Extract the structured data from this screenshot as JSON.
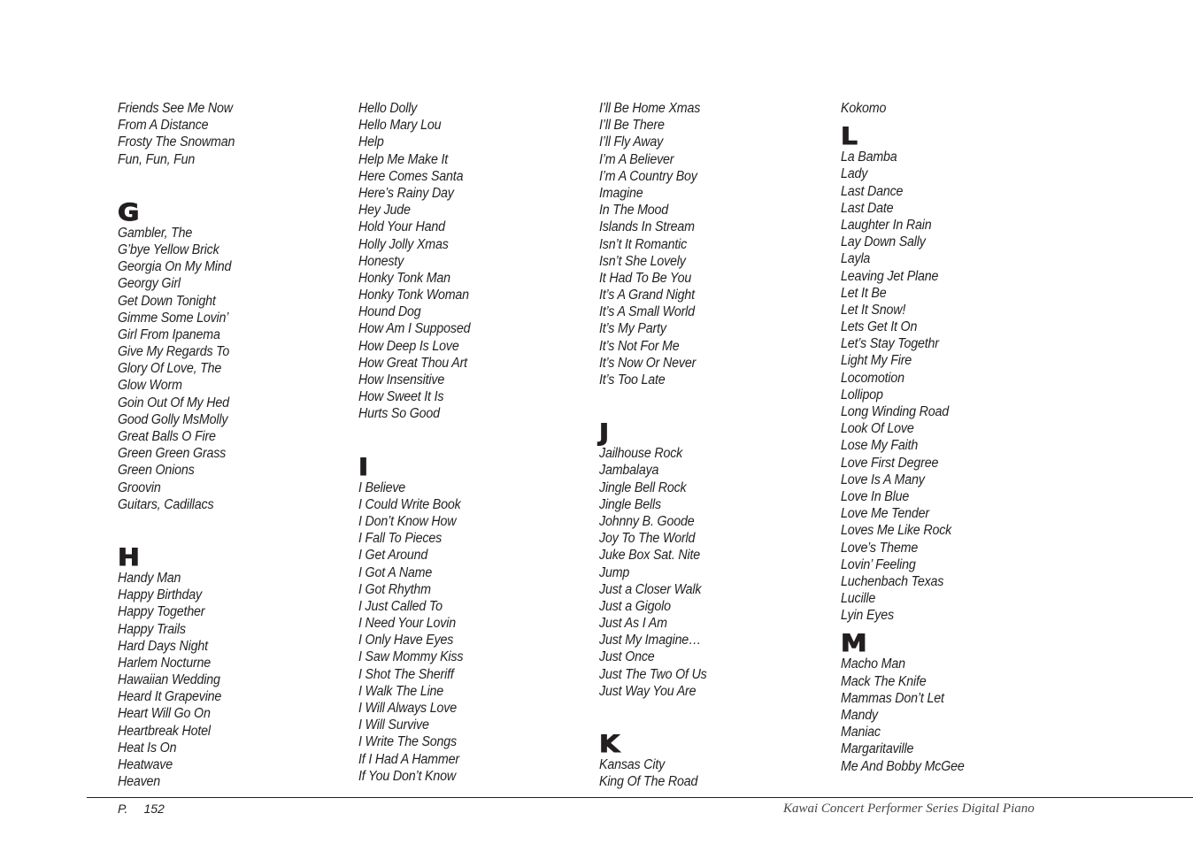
{
  "columns": [
    {
      "blocks": [
        {
          "letter": "",
          "songs": [
            "Friends See Me Now",
            "From A Distance",
            "Frosty The Snowman",
            "Fun, Fun, Fun"
          ]
        },
        {
          "letter": "G",
          "songs": [
            "Gambler, The",
            "G’bye Yellow Brick",
            "Georgia On My Mind",
            "Georgy Girl",
            "Get Down Tonight",
            "Gimme Some Lovin’",
            "Girl From Ipanema",
            "Give My Regards To",
            "Glory Of Love, The",
            "Glow Worm",
            "Goin Out Of My Hed",
            "Good Golly MsMolly",
            "Great Balls O Fire",
            "Green Green Grass",
            "Green Onions",
            "Groovin",
            "Guitars, Cadillacs"
          ]
        },
        {
          "letter": "H",
          "songs": [
            "Handy Man",
            "Happy Birthday",
            "Happy Together",
            "Happy Trails",
            "Hard Days Night",
            "Harlem Nocturne",
            "Hawaiian Wedding",
            "Heard It Grapevine",
            "Heart Will Go On",
            "Heartbreak Hotel",
            "Heat Is On",
            "Heatwave",
            "Heaven"
          ]
        }
      ]
    },
    {
      "blocks": [
        {
          "letter": "",
          "songs": [
            "Hello Dolly",
            "Hello Mary Lou",
            "Help",
            "Help Me Make It",
            "Here Comes Santa",
            "Here’s Rainy Day",
            "Hey Jude",
            "Hold Your Hand",
            "Holly Jolly Xmas",
            "Honesty",
            "Honky Tonk Man",
            "Honky Tonk Woman",
            "Hound Dog",
            "How Am I Supposed",
            "How Deep Is Love",
            "How Great Thou Art",
            "How Insensitive",
            "How Sweet It Is",
            "Hurts So Good"
          ]
        },
        {
          "letter": "I",
          "songs": [
            "I Believe",
            "I Could Write Book",
            "I Don’t Know How",
            "I Fall To Pieces",
            "I Get Around",
            "I Got A Name",
            "I Got Rhythm",
            "I Just Called To",
            "I Need Your Lovin",
            "I Only Have Eyes",
            "I Saw Mommy Kiss",
            "I Shot The Sheriff",
            "I Walk The Line",
            "I Will Always Love",
            "I Will Survive",
            "I Write The Songs",
            "If I Had A Hammer",
            "If You Don’t Know"
          ]
        }
      ]
    },
    {
      "blocks": [
        {
          "letter": "",
          "songs": [
            "I’ll Be Home Xmas",
            "I’ll Be There",
            "I’ll Fly Away",
            "I’m A Believer",
            "I’m A Country Boy",
            "Imagine",
            "In The Mood",
            "Islands In Stream",
            "Isn’t It Romantic",
            "Isn’t She Lovely",
            "It Had To Be You",
            "It’s A Grand Night",
            "It’s A Small World",
            "It’s My Party",
            "It’s Not For Me",
            "It’s Now Or Never",
            "It’s Too Late"
          ]
        },
        {
          "letter": "J",
          "songs": [
            "Jailhouse Rock",
            "Jambalaya",
            "Jingle Bell Rock",
            "Jingle Bells",
            "Johnny B. Goode",
            "Joy To The World",
            "Juke Box Sat. Nite",
            "Jump",
            "Just a Closer Walk",
            "Just a Gigolo",
            "Just As I Am",
            "Just My Imagine…",
            "Just Once",
            "Just The Two Of Us",
            "Just Way You Are"
          ]
        },
        {
          "letter": "K",
          "songs": [
            "Kansas City",
            "King Of The Road"
          ]
        }
      ]
    },
    {
      "blocks": [
        {
          "letter": "",
          "songs": [
            "Kokomo"
          ]
        },
        {
          "letter": "L",
          "songs": [
            "La Bamba",
            "Lady",
            "Last Dance",
            "Last Date",
            "Laughter In Rain",
            "Lay Down Sally",
            "Layla",
            "Leaving Jet Plane",
            "Let It Be",
            "Let It Snow!",
            "Lets Get It On",
            "Let’s Stay Togethr",
            "Light My Fire",
            "Locomotion",
            "Lollipop",
            "Long Winding Road",
            "Look Of Love",
            "Lose My Faith",
            "Love First Degree",
            "Love Is A Many",
            "Love In Blue",
            "Love Me Tender",
            "Loves Me Like Rock",
            "Love’s Theme",
            "Lovin’  Feeling",
            "Luchenbach Texas",
            "Lucille",
            "Lyin Eyes"
          ]
        },
        {
          "letter": "M",
          "songs": [
            "Macho Man",
            "Mack The Knife",
            "Mammas Don’t Let",
            "Mandy",
            "Maniac",
            "Margaritaville",
            "Me And Bobby McGee"
          ]
        }
      ]
    }
  ],
  "footer": {
    "page_prefix": "P.",
    "page_number": "152",
    "title": "Kawai Concert Performer Series Digital Piano"
  }
}
